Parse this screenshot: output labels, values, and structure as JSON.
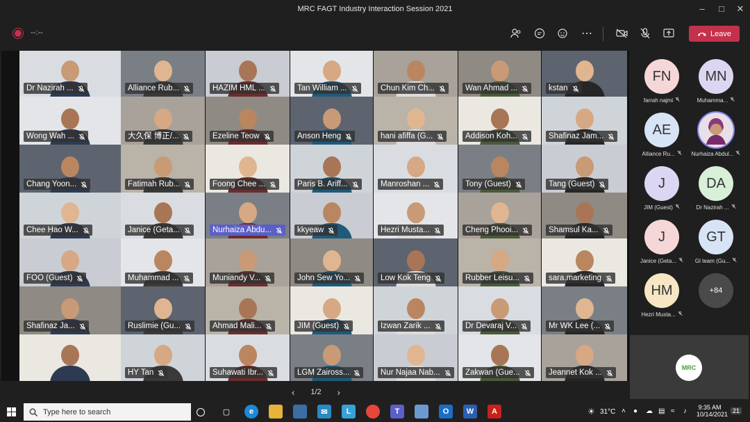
{
  "window": {
    "title": "MRC FAGT Industry Interaction Session 2021"
  },
  "toolbar": {
    "timer": "--:--",
    "leave_label": "Leave"
  },
  "grid": {
    "rows": [
      [
        "Dr Nazirah ...",
        "Alliance Rub...",
        "HAZIM HML ...",
        "Tan William ...",
        "Chun Kim Ch...",
        "Wan Ahmad ...",
        "kstan"
      ],
      [
        "Wong Wah ...",
        "大久保 博正/...",
        "Ezeline Teow",
        "Anson Heng",
        "hani afiffa (G...",
        "Addison Koh...",
        "Shafinaz Jam..."
      ],
      [
        "Chang Yoon...",
        "Fatimah Rub...",
        "Foong Chee ...",
        "Paris B. Ariff...",
        "Manroshan ...",
        "Tony (Guest)",
        "Tang (Guest)"
      ],
      [
        "Chee Hao W...",
        "Janice (Geta...",
        "Nurhaiza Abdu...",
        "kkyeaw",
        "Hezri Musta...",
        "Cheng Phooi...",
        "Shamsul Ka..."
      ],
      [
        "FOO (Guest)",
        "Muhammad ...",
        "Muniandy V...",
        "John Sew Yo...",
        "Low Kok Teng",
        "Rubber Leisu...",
        "sara.marketing"
      ],
      [
        "Shafinaz Ja...",
        "Ruslimie (Gu...",
        "Ahmad Mali...",
        "JIM (Guest)",
        "Izwan Zarik ...",
        "Dr Devaraj V...",
        "Mr WK Lee (..."
      ],
      [
        "",
        "HY Tan",
        "Suhawati Ibr...",
        "LGM Zaiross...",
        "Nur Najaa Nab...",
        "Zakwan (Gue...",
        "Jeannet Kok ..."
      ]
    ]
  },
  "pager": {
    "label": "1/2"
  },
  "roster": [
    {
      "initials": "FN",
      "name": "farrah najmi",
      "color": "#f6d7d7"
    },
    {
      "initials": "MN",
      "name": "Muhamma...",
      "color": "#dcd6f2"
    },
    {
      "initials": "AE",
      "name": "Alliance Ru...",
      "color": "#d7e4f5"
    },
    {
      "initials": "",
      "name": "Nurhaiza Abdul...",
      "color": "#b88a6c"
    },
    {
      "initials": "J",
      "name": "JIM (Guest)",
      "color": "#dcd6f2"
    },
    {
      "initials": "DA",
      "name": "Dr Nazirah ...",
      "color": "#d8efd8"
    },
    {
      "initials": "J",
      "name": "Janice (Geta...",
      "color": "#f6d7d7"
    },
    {
      "initials": "GT",
      "name": "Gl team (Gu...",
      "color": "#d7e4f5"
    },
    {
      "initials": "HM",
      "name": "Hezri Musta...",
      "color": "#f6e6c4"
    },
    {
      "initials": "+84",
      "name": "",
      "color": "#4a4a4a"
    }
  ],
  "self_view": {
    "logo_text": "MRC"
  },
  "taskbar": {
    "search_placeholder": "Type here to search",
    "weather": "31°C",
    "time": "9:35 AM",
    "date": "10/14/2021",
    "notif_count": "21"
  }
}
